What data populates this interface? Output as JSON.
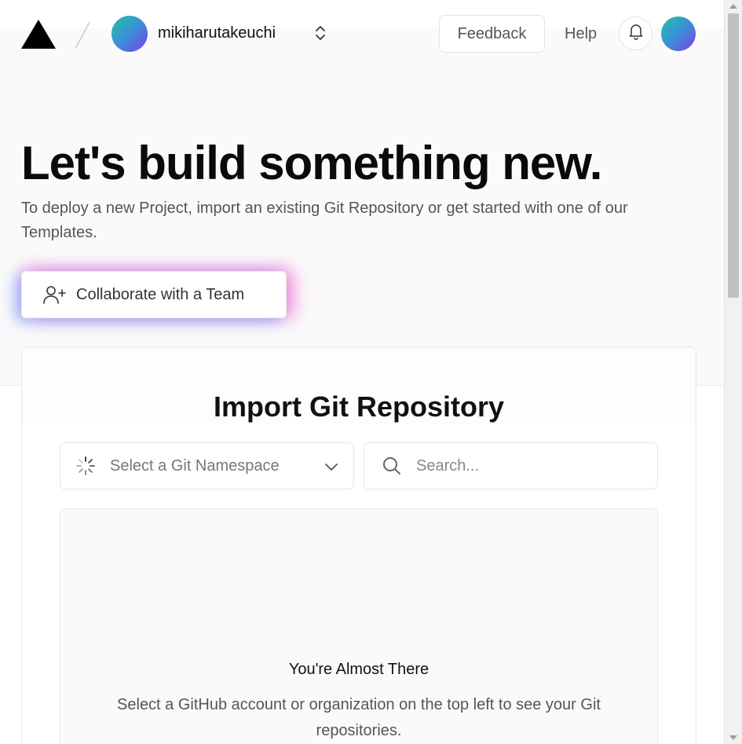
{
  "header": {
    "username": "mikiharutakeuchi",
    "feedback_label": "Feedback",
    "help_label": "Help"
  },
  "hero": {
    "title": "Let's build something new.",
    "subtitle": "To deploy a new Project, import an existing Git Repository or get started with one of our Templates.",
    "collaborate_label": "Collaborate with a Team"
  },
  "import": {
    "title": "Import Git Repository",
    "namespace_placeholder": "Select a Git Namespace",
    "search_placeholder": "Search...",
    "empty_title": "You're Almost There",
    "empty_description": "Select a GitHub account or organization on the top left to see your Git repositories."
  },
  "icons": {
    "logo": "triangle-logo-icon",
    "switcher": "chevron-up-down-icon",
    "bell": "bell-icon",
    "collaborate": "user-plus-icon",
    "spinner": "loading-spinner-icon",
    "dropdown": "chevron-down-icon",
    "search": "search-icon"
  },
  "colors": {
    "avatar_gradient": [
      "#22c1a0",
      "#3b8fd9",
      "#7b3fe4"
    ],
    "glow_blue": "#5a8cff",
    "glow_pink": "#f05ac8"
  }
}
